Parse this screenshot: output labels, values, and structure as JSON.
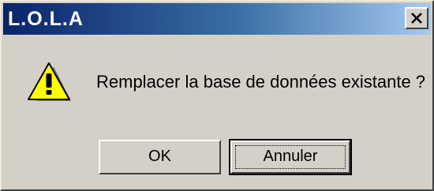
{
  "window": {
    "title": "L.O.L.A",
    "close_icon": "close-icon"
  },
  "dialog": {
    "icon": "warning-icon",
    "message": "Remplacer la base de données existante ?"
  },
  "buttons": {
    "ok_label": "OK",
    "cancel_label": "Annuler"
  },
  "colors": {
    "titlebar_start": "#0a246a",
    "titlebar_end": "#a6caf0",
    "dialog_face": "#d4d0c8",
    "warning_yellow": "#ffff00"
  }
}
